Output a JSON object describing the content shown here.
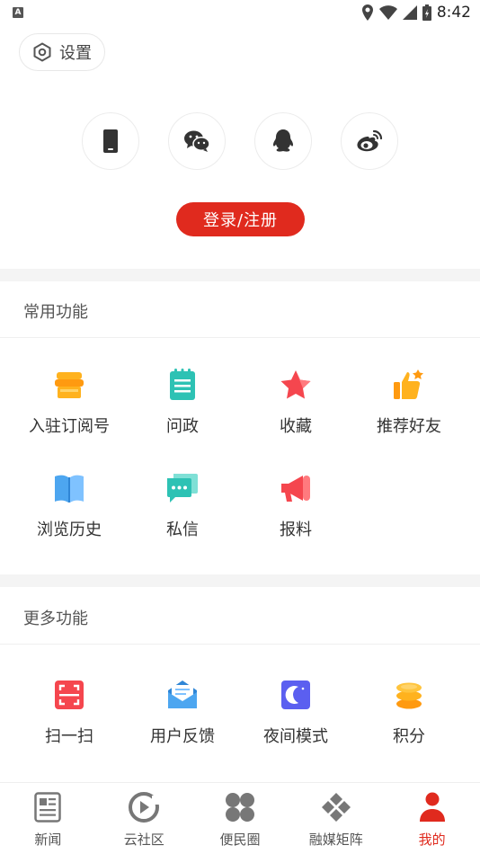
{
  "status_bar": {
    "time": "8:42",
    "app_badge": "A"
  },
  "header": {
    "settings_label": "设置",
    "login_button": "登录/注册",
    "login_methods": [
      "phone-icon",
      "wechat-icon",
      "qq-icon",
      "weibo-icon"
    ]
  },
  "common": {
    "title": "常用功能",
    "items": [
      {
        "label": "入驻订阅号",
        "icon": "store-icon"
      },
      {
        "label": "问政",
        "icon": "notepad-icon"
      },
      {
        "label": "收藏",
        "icon": "star-icon"
      },
      {
        "label": "推荐好友",
        "icon": "thumbs-up-icon"
      },
      {
        "label": "浏览历史",
        "icon": "book-icon"
      },
      {
        "label": "私信",
        "icon": "chat-icon"
      },
      {
        "label": "报料",
        "icon": "megaphone-icon"
      }
    ]
  },
  "more": {
    "title": "更多功能",
    "items": [
      {
        "label": "扫一扫",
        "icon": "scan-icon"
      },
      {
        "label": "用户反馈",
        "icon": "mail-icon"
      },
      {
        "label": "夜间模式",
        "icon": "moon-icon"
      },
      {
        "label": "积分",
        "icon": "coins-icon"
      }
    ]
  },
  "bottom_nav": {
    "items": [
      {
        "label": "新闻",
        "icon": "news-icon"
      },
      {
        "label": "云社区",
        "icon": "community-icon"
      },
      {
        "label": "便民圈",
        "icon": "grid-circles-icon"
      },
      {
        "label": "融媒矩阵",
        "icon": "diamond-matrix-icon"
      },
      {
        "label": "我的",
        "icon": "person-icon"
      }
    ],
    "active_index": 4
  },
  "colors": {
    "accent": "#e02a1e"
  }
}
